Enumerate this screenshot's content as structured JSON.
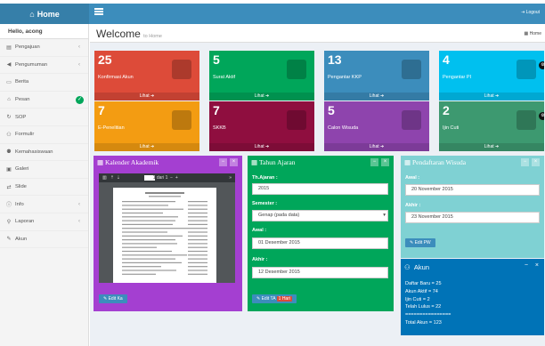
{
  "header": {
    "logo": "Home",
    "logout": "Logout"
  },
  "sidebar": {
    "user": "Hello, acong",
    "items": [
      {
        "label": "Pengajuan",
        "icon": "book-icon",
        "glyph": "▤",
        "arrow": "‹"
      },
      {
        "label": "Pengumuman",
        "icon": "megaphone-icon",
        "glyph": "◀",
        "arrow": "‹"
      },
      {
        "label": "Berita",
        "icon": "monitor-icon",
        "glyph": "▭",
        "arrow": ""
      },
      {
        "label": "Pesan",
        "icon": "envelope-icon",
        "glyph": "⌂",
        "arrow": ""
      },
      {
        "label": "SOP",
        "icon": "refresh-icon",
        "glyph": "↻",
        "arrow": ""
      },
      {
        "label": "Formulir",
        "icon": "users-icon",
        "glyph": "⚇",
        "arrow": ""
      },
      {
        "label": "Kemahasiswaan",
        "icon": "group-icon",
        "glyph": "⚉",
        "arrow": ""
      },
      {
        "label": "Galeri",
        "icon": "image-icon",
        "glyph": "▣",
        "arrow": ""
      },
      {
        "label": "Slide",
        "icon": "exchange-icon",
        "glyph": "⇄",
        "arrow": ""
      },
      {
        "label": "Info",
        "icon": "info-icon",
        "glyph": "ⓘ",
        "arrow": "‹"
      },
      {
        "label": "Laporan",
        "icon": "search-icon",
        "glyph": "⚲",
        "arrow": "‹"
      },
      {
        "label": "Akun",
        "icon": "edit-icon",
        "glyph": "✎",
        "arrow": ""
      }
    ]
  },
  "page": {
    "title": "Welcome",
    "subtitle": "to Home",
    "breadcrumb": "Home"
  },
  "tiles": [
    {
      "num": "25",
      "label": "Konfirmasi Akun",
      "more": "Lihat",
      "color": "#dd4b39",
      "icon": "add-user-icon"
    },
    {
      "num": "5",
      "label": "Surat Aktif",
      "more": "Lihat",
      "color": "#00a65a",
      "icon": "printer-icon"
    },
    {
      "num": "13",
      "label": "Pengantar KKP",
      "more": "Lihat",
      "color": "#3c8dbc",
      "icon": "printer-icon"
    },
    {
      "num": "4",
      "label": "Pengantar PI",
      "more": "Lihat",
      "color": "#00c0ef",
      "icon": "printer-icon"
    },
    {
      "num": "7",
      "label": "E-Penelitian",
      "more": "Lihat",
      "color": "#f39c12",
      "icon": "printer-icon"
    },
    {
      "num": "7",
      "label": "SKKB",
      "more": "Lihat",
      "color": "#8f0e3f",
      "icon": "printer-icon"
    },
    {
      "num": "5",
      "label": "Calon Wisuda",
      "more": "Lihat",
      "color": "#8e44ad",
      "icon": "group-icon"
    },
    {
      "num": "2",
      "label": "Ijin Cuti",
      "more": "Lihat",
      "color": "#3d9970",
      "icon": "lock-icon"
    }
  ],
  "kalender": {
    "title": "Kalender Akademik",
    "page": "1",
    "of": "dari 1",
    "btn": "Edit Ka",
    "color": "#a43fd1"
  },
  "tahun": {
    "title": "Tahun Ajaran",
    "l1": "Th.Ajaran :",
    "v1": "2015",
    "l2": "Semester :",
    "v2": "Genap (pada data)",
    "l3": "Awal :",
    "v3": "01 Desember 2015",
    "l4": "Akhir :",
    "v4": "12 Desember 2015",
    "btn": "Edit TA",
    "badge": "1 Hari",
    "color": "#00a65a"
  },
  "wisuda": {
    "title": "Pendaftaran Wisuda",
    "l1": "Awal :",
    "v1": "20 November 2015",
    "l2": "Akhir :",
    "v2": "23 November 2015",
    "btn": "Edit PW",
    "color": "#7fd1d3"
  },
  "akun": {
    "title": "Akun",
    "lines": [
      "Daftar Baru = 25",
      "Akun Aktif = 74",
      "Ijin Cuti    = 2",
      "Telah Lulus = 22",
      "================",
      "Total Akun = 123"
    ],
    "color": "#0073b7"
  }
}
